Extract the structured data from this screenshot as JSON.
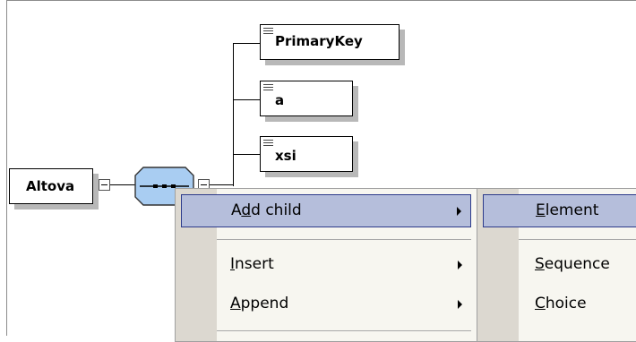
{
  "diagram": {
    "root_element": "Altova",
    "children": [
      {
        "label": "PrimaryKey"
      },
      {
        "label": "a"
      },
      {
        "label": "xsi"
      }
    ],
    "compositor_icon": "sequence-compositor-icon"
  },
  "context_menu": {
    "items": [
      {
        "label": "Add child",
        "accel_index": 1,
        "submenu": true,
        "selected": true
      },
      {
        "label": "Insert",
        "accel_index": 0,
        "submenu": true,
        "selected": false
      },
      {
        "label": "Append",
        "accel_index": 0,
        "submenu": true,
        "selected": false
      }
    ]
  },
  "submenu": {
    "items": [
      {
        "label": "Element",
        "accel_index": 0,
        "selected": true
      },
      {
        "label": "Sequence",
        "accel_index": 0,
        "selected": false
      },
      {
        "label": "Choice",
        "accel_index": 0,
        "selected": false
      }
    ]
  },
  "colors": {
    "compositor_fill": "#a9cdf2",
    "menu_highlight": "#b5bedb",
    "menu_highlight_border": "#2c3a8a",
    "menu_background": "#f7f6f0",
    "menu_gutter": "#dcd8d0"
  }
}
